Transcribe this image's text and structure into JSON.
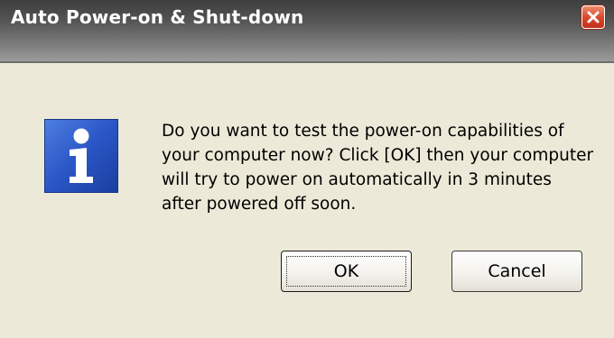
{
  "window": {
    "title": "Auto Power-on & Shut-down",
    "close_icon": "close-icon"
  },
  "dialog": {
    "icon": "information-icon",
    "message": "Do you want to test the power-on capabilities of your computer now? Click [OK] then your computer will try to power on automatically in 3 minutes after powered off soon.",
    "ok_label": "OK",
    "cancel_label": "Cancel"
  },
  "colors": {
    "dialog_background": "#ece9d8",
    "titlebar_dark": "#3e3e3e",
    "titlebar_light": "#9a9a9a",
    "close_button": "#d9452a",
    "info_icon_blue": "#2a56c6"
  }
}
